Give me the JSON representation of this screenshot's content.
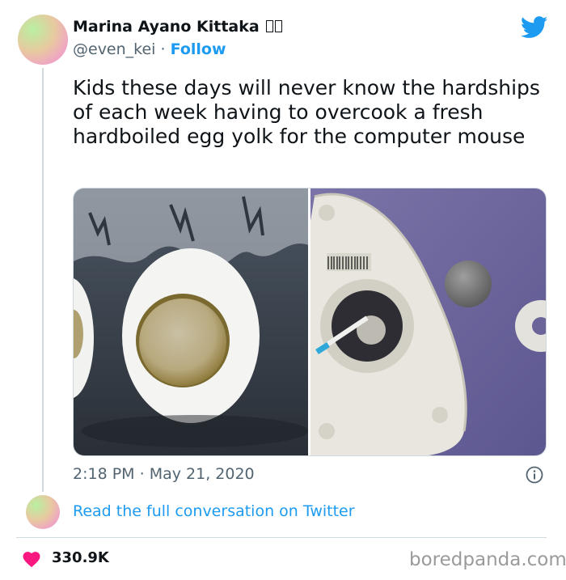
{
  "author": {
    "name": "Marina Ayano Kittaka",
    "handle": "@even_kei",
    "separator": "·",
    "follow_label": "Follow"
  },
  "tweet": {
    "text": "Kids these days will never know the hardships of each week having to overcook a fresh hardboiled egg yolk for the computer mouse"
  },
  "meta": {
    "time": "2:18 PM",
    "separator": "·",
    "date": "May 21, 2020"
  },
  "footer": {
    "read_link": "Read the full conversation on Twitter",
    "likes": "330.9K",
    "watermark": "boredpanda.com"
  },
  "colors": {
    "accent": "#1d9bf0",
    "like": "#f91880",
    "text": "#0f1419",
    "muted": "#536471"
  },
  "icons": [
    "twitter-bird-icon",
    "info-icon",
    "heart-icon"
  ]
}
